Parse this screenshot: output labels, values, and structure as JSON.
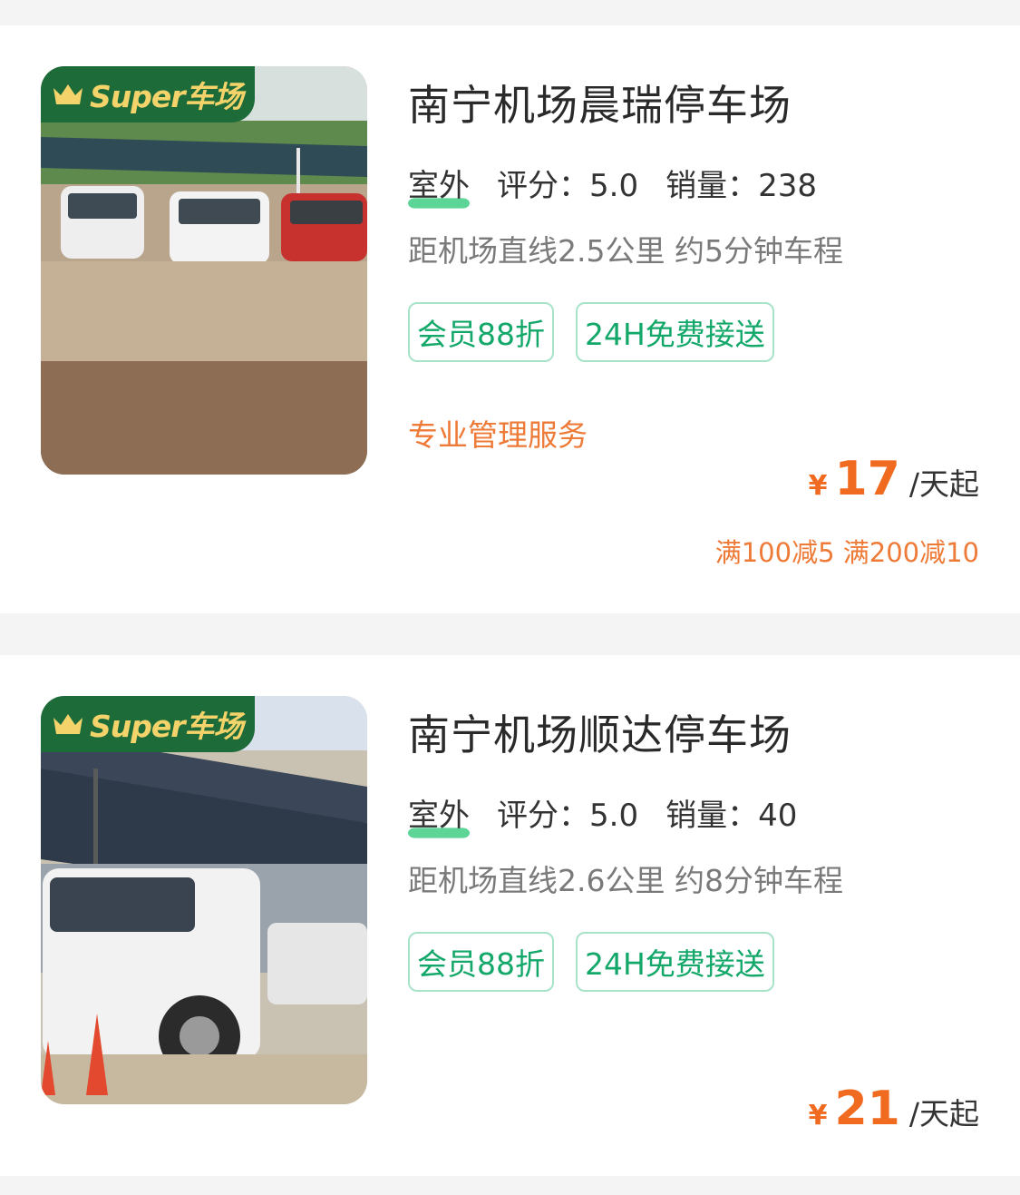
{
  "lots": [
    {
      "badge": "Super车场",
      "title": "南宁机场晨瑞停车场",
      "type": "室外",
      "rating": "评分：5.0",
      "sales": "销量：238",
      "distance": "距机场直线2.5公里 约5分钟车程",
      "tags": [
        "会员88折",
        "24H免费接送"
      ],
      "service": "专业管理服务",
      "currency": "¥",
      "price": "17",
      "price_unit": "/天起",
      "promo": "满100减5 满200减10"
    },
    {
      "badge": "Super车场",
      "title": "南宁机场顺达停车场",
      "type": "室外",
      "rating": "评分：5.0",
      "sales": "销量：40",
      "distance": "距机场直线2.6公里 约8分钟车程",
      "tags": [
        "会员88折",
        "24H免费接送"
      ],
      "currency": "¥",
      "price": "21",
      "price_unit": "/天起"
    }
  ],
  "colors": {
    "accent_green": "#13a86a",
    "badge_green": "#1e6b3a",
    "badge_gold": "#f4d46a",
    "price_orange": "#f06a1f",
    "promo_orange": "#ee7a37"
  }
}
